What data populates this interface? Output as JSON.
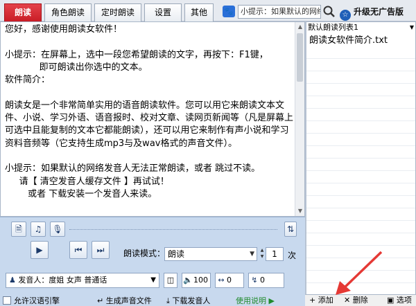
{
  "tabs": [
    {
      "label": "朗读",
      "active": true
    },
    {
      "label": "角色朗读"
    },
    {
      "label": "定时朗读"
    },
    {
      "label": "设置"
    },
    {
      "label": "其他"
    }
  ],
  "tip_box": "小提示：如果默认的网络",
  "upgrade_label": "升级无广告版",
  "main_text": "您好，感谢使用朗读女软件！\n\n小提示：在屏幕上，选中一段您希望朗读的文字，再按下：F1键，\n            即可朗读出你选中的文本。\n软件简介：\n\n朗读女是一个非常简单实用的语音朗读软件。您可以用它来朗读文本文件、小说、学习外语、语音报时、校对文章、读网页新闻等（凡是屏幕上可选中且能复制的文本它都能朗读），还可以用它来制作有声小说和学习资料音频等（它支持生成mp3与及wav格式的声音文件）。\n\n小提示：如果默认的网络发音人无法正常朗读，或者 跳过不读。\n     请【 清空发音人缓存文件 】再试试！\n        或者 下载安装一个发音人来读。",
  "controls": {
    "mode_label": "朗读模式：",
    "mode_value": "朗读",
    "count_value": "1",
    "count_unit": "次",
    "voice_prefix": "发音人：",
    "voice_value": "度姐 女声 普通话",
    "volume": "100",
    "speed": "0",
    "pitch": "0"
  },
  "bottom": {
    "allow_chinese_engine": "允许汉语引擎",
    "generate_audio": "生成声音文件",
    "download_voice": "下载发音人",
    "help": "使用说明 ▶"
  },
  "right_panel": {
    "list_name": "默认朗读列表1",
    "items": [
      "朗读女软件简介.txt"
    ],
    "add_label": "添加",
    "delete_label": "删除",
    "options_label": "选项"
  },
  "colors": {
    "active_tab": "#d32f2f",
    "panel_bg": "#c8d9ee",
    "help_text": "#1f8a2c",
    "arrow": "#e53935"
  }
}
